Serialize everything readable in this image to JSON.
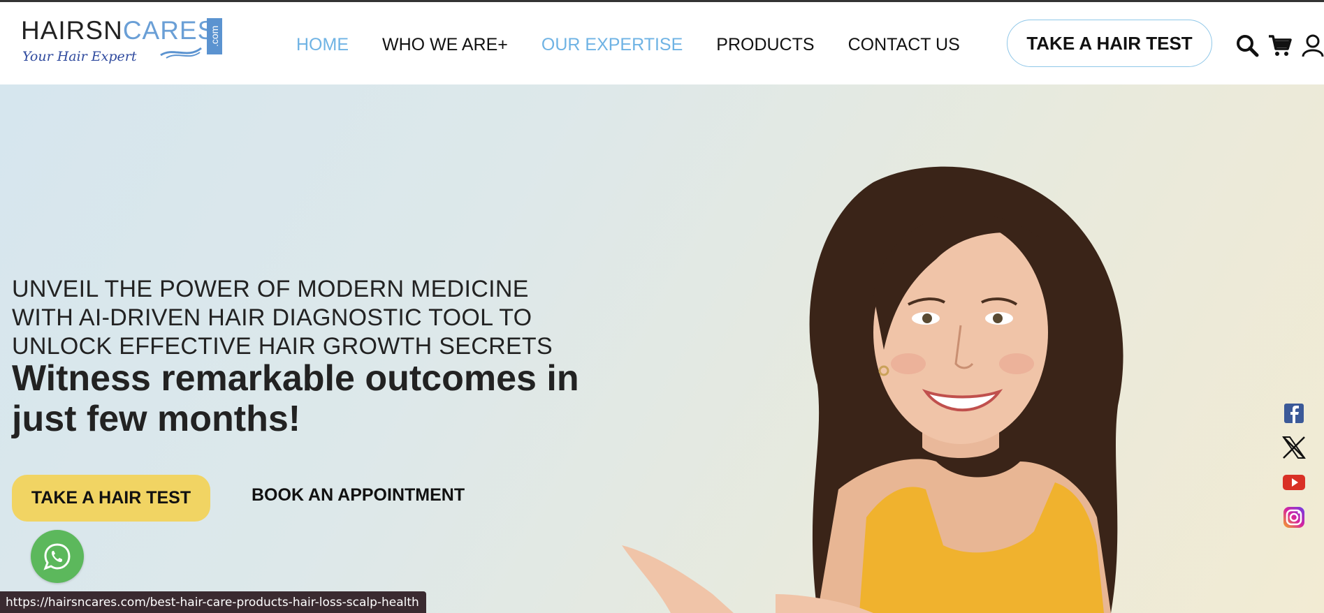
{
  "header": {
    "logo": {
      "word_dark": "HAIRSN",
      "word_blue": "CARES",
      "com": ".com",
      "tagline": "Your Hair Expert"
    },
    "nav": [
      {
        "label": "HOME",
        "active": true
      },
      {
        "label": "WHO WE ARE+",
        "active": false
      },
      {
        "label": "OUR EXPERTISE",
        "active": true
      },
      {
        "label": "PRODUCTS",
        "active": false
      },
      {
        "label": "CONTACT US",
        "active": false
      }
    ],
    "cta_label": "TAKE A HAIR TEST",
    "icons": [
      "search-icon",
      "cart-icon",
      "user-icon"
    ]
  },
  "hero": {
    "kicker": "UNVEIL THE POWER OF MODERN MEDICINE WITH AI-DRIVEN HAIR DIAGNOSTIC TOOL TO UNLOCK EFFECTIVE HAIR GROWTH SECRETS",
    "headline": "Witness remarkable outcomes in just few months!",
    "primary_button": "TAKE A HAIR TEST",
    "secondary_button": "BOOK AN APPOINTMENT"
  },
  "social": [
    "facebook-icon",
    "x-icon",
    "youtube-icon",
    "instagram-icon"
  ],
  "status_bar": {
    "url": "https://hairsncares.com/best-hair-care-products-hair-loss-scalp-health"
  },
  "colors": {
    "accent_blue": "#6fb3e4",
    "button_yellow": "#f1d463",
    "whatsapp_green": "#5cb85c"
  }
}
